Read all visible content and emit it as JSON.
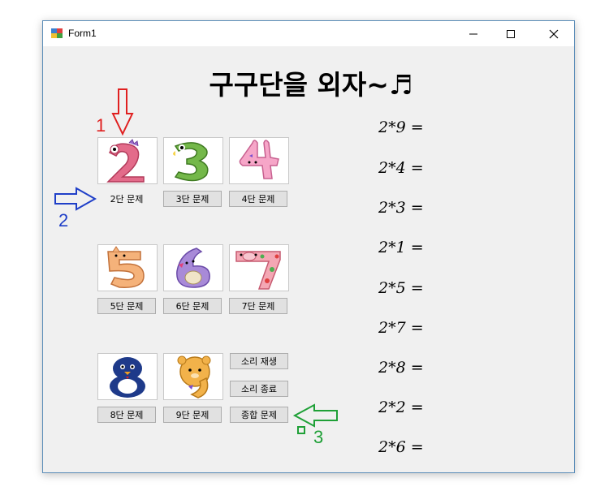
{
  "window": {
    "title": "Form1",
    "controls": {
      "minimize": "─",
      "maximize": "□",
      "close": "✕"
    }
  },
  "heading": "구구단을 외자~♬",
  "tiles": [
    {
      "icon": "pink-dinosaur-2-icon",
      "button": "2단 문제"
    },
    {
      "icon": "green-dinosaur-3-icon",
      "button": "3단 문제"
    },
    {
      "icon": "pink-rabbit-4-icon",
      "button": "4단 문제"
    },
    {
      "icon": "orange-cat-5-icon",
      "button": "5단 문제"
    },
    {
      "icon": "purple-seal-6-icon",
      "button": "6단 문제"
    },
    {
      "icon": "polka-dot-pig-7-icon",
      "button": "7단 문제"
    },
    {
      "icon": "blue-penguin-8-icon",
      "button": "8단 문제"
    },
    {
      "icon": "yellow-bear-9-icon",
      "button": "9단 문제"
    }
  ],
  "sound": {
    "play": "소리 재생",
    "stop": "소리 종료",
    "all": "종합 문제"
  },
  "problems": [
    "2*9 =",
    "2*4 =",
    "2*3 =",
    "2*1 =",
    "2*5 =",
    "2*7 =",
    "2*8 =",
    "2*2 =",
    "2*6 ="
  ],
  "annotations": {
    "one": "1",
    "two": "2",
    "three": "3",
    "red": "#e02020",
    "blue": "#1f3fc8",
    "green": "#1fa037"
  }
}
